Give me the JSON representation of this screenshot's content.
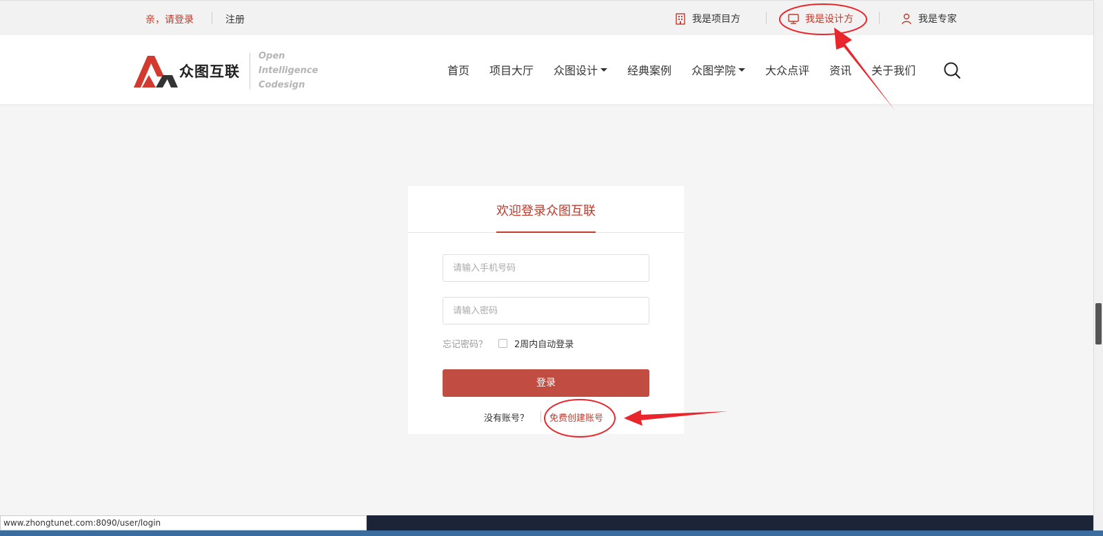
{
  "topbar": {
    "login_text": "亲，请登录",
    "register": "注册",
    "roles": [
      {
        "label": "我是项目方",
        "icon": "building-icon"
      },
      {
        "label": "我是设计方",
        "icon": "monitor-icon"
      },
      {
        "label": "我是专家",
        "icon": "user-icon"
      }
    ]
  },
  "logo": {
    "cn": "众图互联",
    "en_lines": [
      "Open",
      "Intelligence",
      "Codesign"
    ]
  },
  "nav": [
    {
      "label": "首页"
    },
    {
      "label": "项目大厅"
    },
    {
      "label": "众图设计",
      "dropdown": true
    },
    {
      "label": "经典案例"
    },
    {
      "label": "众图学院",
      "dropdown": true
    },
    {
      "label": "大众点评"
    },
    {
      "label": "资讯"
    },
    {
      "label": "关于我们"
    }
  ],
  "login": {
    "title": "欢迎登录众图互联",
    "phone_placeholder": "请输入手机号码",
    "password_placeholder": "请输入密码",
    "forgot": "忘记密码？",
    "remember": "2周内自动登录",
    "submit": "登录",
    "no_account": "没有账号？",
    "create": "免费创建账号"
  },
  "status_url": "www.zhongtunet.com:8090/user/login",
  "colors": {
    "accent": "#c0392b",
    "button": "#c14d42",
    "annotation": "#e8262b"
  }
}
